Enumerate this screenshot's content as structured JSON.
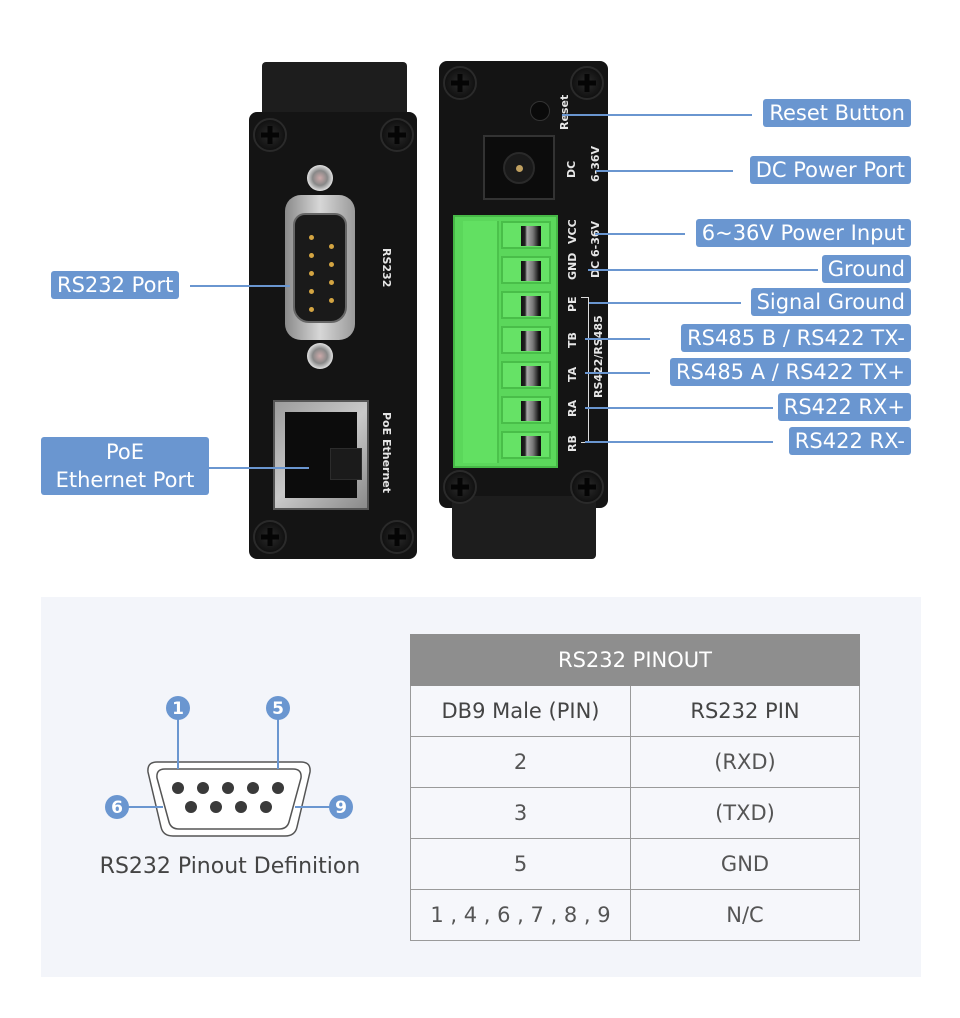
{
  "device_left": {
    "rs232_silk": "RS232",
    "ethernet_silk": "PoE Ethernet"
  },
  "device_right": {
    "silk": {
      "reset": "Reset",
      "dc": "DC",
      "dc_voltage": "6-36V",
      "vcc": "VCC",
      "vcc_voltage": "DC 6-36V",
      "gnd": "GND",
      "pe": "PE",
      "tb": "TB",
      "ta": "TA",
      "ra": "RA",
      "rb": "RB",
      "bus_group": "RS422/RS485"
    }
  },
  "callouts": {
    "left": [
      {
        "label": "RS232 Port"
      },
      {
        "label_line1": "PoE",
        "label_line2": "Ethernet Port"
      }
    ],
    "right": [
      {
        "label": "Reset Button"
      },
      {
        "label": "DC Power Port"
      },
      {
        "label": "6~36V Power Input"
      },
      {
        "label": "Ground"
      },
      {
        "label": "Signal Ground"
      },
      {
        "label": "RS485 B / RS422 TX-"
      },
      {
        "label": "RS485 A / RS422 TX+"
      },
      {
        "label": "RS422 RX+"
      },
      {
        "label": "RS422 RX-"
      }
    ]
  },
  "pinout_diagram": {
    "pin_markers": [
      "1",
      "5",
      "6",
      "9"
    ],
    "caption": "RS232 Pinout Definition"
  },
  "pinout_table": {
    "title": "RS232 PINOUT",
    "headers": [
      "DB9 Male (PIN)",
      "RS232 PIN"
    ],
    "rows": [
      [
        "2",
        "(RXD)"
      ],
      [
        "3",
        "(TXD)"
      ],
      [
        "5",
        "GND"
      ],
      [
        "1 , 4 , 6 , 7 , 8 , 9",
        "N/C"
      ]
    ]
  },
  "colors": {
    "accent_blue": "#6a96d0",
    "terminal_green": "#5bd75b",
    "table_header_gray": "#8e8e8e",
    "panel_bg": "#f3f5fa"
  }
}
